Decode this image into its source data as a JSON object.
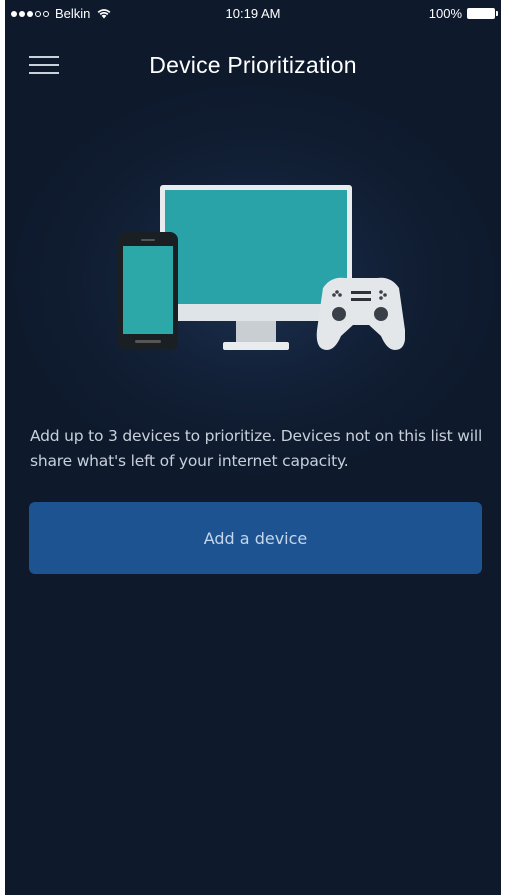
{
  "status_bar": {
    "carrier": "Belkin",
    "time": "10:19 AM",
    "battery": "100%",
    "signal_bars_filled": 3,
    "signal_bars_total": 5
  },
  "header": {
    "title": "Device Prioritization",
    "menu_icon": "hamburger-menu-icon"
  },
  "main": {
    "illustration_icons": [
      "smartphone-icon",
      "monitor-icon",
      "gamepad-icon"
    ],
    "description": "Add up to 3 devices to prioritize. Devices not on this list will share what's left of your internet capacity.",
    "add_button_label": "Add a device"
  },
  "colors": {
    "background": "#0f1b2e",
    "button": "#1d5391",
    "screen_teal": "#2aa3a8"
  }
}
